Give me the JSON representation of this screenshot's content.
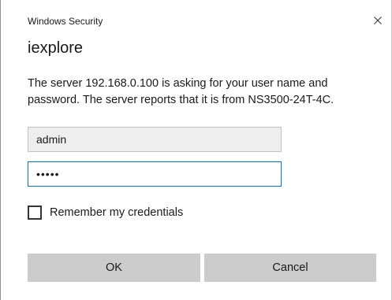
{
  "window": {
    "title": "Windows Security",
    "close_icon": "close-icon"
  },
  "dialog": {
    "app_name": "iexplore",
    "message": "The server 192.168.0.100 is asking for your user name and password. The server reports that it is from NS3500-24T-4C."
  },
  "form": {
    "username_value": "admin",
    "password_masked": "•••••",
    "remember_label": "Remember my credentials",
    "remember_checked": false
  },
  "buttons": {
    "ok_label": "OK",
    "cancel_label": "Cancel"
  },
  "colors": {
    "focus_border": "#0078d7",
    "button_bg": "#cccccc",
    "input_bg": "#eeeeee"
  }
}
